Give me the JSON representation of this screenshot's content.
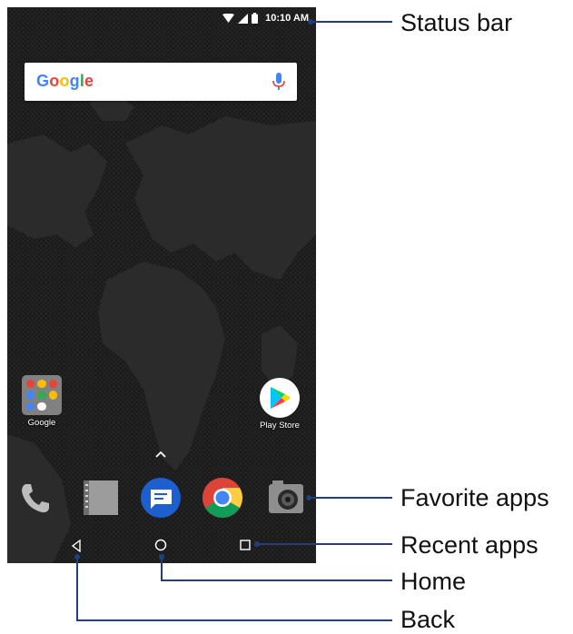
{
  "status_bar": {
    "time": "10:10 AM",
    "icons": [
      "wifi-icon",
      "signal-icon",
      "battery-icon"
    ]
  },
  "search": {
    "logo": "Google",
    "mic_icon": "mic-icon"
  },
  "home_apps": [
    {
      "label": "Google",
      "icon": "google-folder-icon"
    },
    {
      "label": "Play Store",
      "icon": "play-store-icon"
    }
  ],
  "dock": [
    "phone-icon",
    "contacts-icon",
    "messages-icon",
    "chrome-icon",
    "camera-icon"
  ],
  "nav": [
    "back-icon",
    "home-icon",
    "recent-apps-icon"
  ],
  "callouts": {
    "status_bar": "Status bar",
    "favorite_apps": "Favorite apps",
    "recent_apps": "Recent apps",
    "home": "Home",
    "back": "Back"
  },
  "colors": {
    "callout": "#1f3f80",
    "wallpaper": "#1b1b1b"
  }
}
